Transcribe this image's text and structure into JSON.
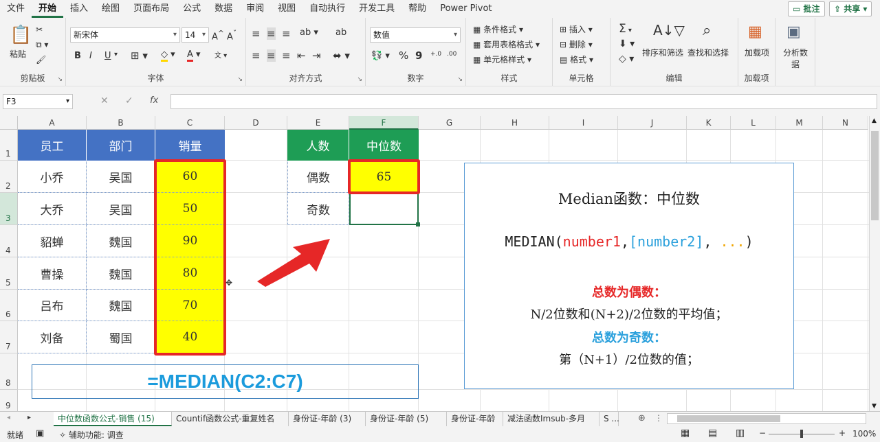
{
  "menu": [
    "文件",
    "开始",
    "插入",
    "绘图",
    "页面布局",
    "公式",
    "数据",
    "审阅",
    "视图",
    "自动执行",
    "开发工具",
    "帮助",
    "Power Pivot"
  ],
  "menu_active": "开始",
  "top_buttons": {
    "comment": "批注",
    "share": "共享"
  },
  "ribbon": {
    "clipboard": {
      "label": "剪贴板",
      "paste": "粘贴"
    },
    "font": {
      "label": "字体",
      "font_name": "新宋体",
      "font_size": "14",
      "bold": "B",
      "italic": "I",
      "underline": "U",
      "grow": "A^",
      "shrink": "Aˇ"
    },
    "align": {
      "label": "对齐方式"
    },
    "number": {
      "label": "数字",
      "format": "数值",
      "percent": "%",
      "comma": "9"
    },
    "styles": {
      "label": "样式",
      "cond": "条件格式",
      "table": "套用表格格式",
      "cell": "单元格样式"
    },
    "cells": {
      "label": "单元格",
      "insert": "插入",
      "delete": "删除",
      "format": "格式"
    },
    "edit": {
      "label": "编辑",
      "sort": "排序和筛选",
      "find": "查找和选择",
      "sum": "Σ"
    },
    "addins": {
      "label": "加载项",
      "addin": "加载项"
    },
    "analysis": {
      "label": "",
      "analyze": "分析数据"
    }
  },
  "formula_bar": {
    "name_box": "F3",
    "fx": "fx",
    "content": ""
  },
  "columns": [
    "A",
    "B",
    "C",
    "D",
    "E",
    "F",
    "G",
    "H",
    "I",
    "J",
    "K",
    "L",
    "M",
    "N"
  ],
  "rows": [
    "1",
    "2",
    "3",
    "4",
    "5",
    "6",
    "7",
    "8",
    "9"
  ],
  "table1": {
    "headers": [
      "员工",
      "部门",
      "销量"
    ],
    "rows": [
      [
        "小乔",
        "吴国",
        "60"
      ],
      [
        "大乔",
        "吴国",
        "50"
      ],
      [
        "貂蝉",
        "魏国",
        "90"
      ],
      [
        "曹操",
        "魏国",
        "80"
      ],
      [
        "吕布",
        "魏国",
        "70"
      ],
      [
        "刘备",
        "蜀国",
        "40"
      ]
    ]
  },
  "table2": {
    "headers": [
      "人数",
      "中位数"
    ],
    "rows": [
      [
        "偶数",
        "65"
      ],
      [
        "奇数",
        ""
      ]
    ]
  },
  "formula_display": "=MEDIAN(C2:C7)",
  "note": {
    "title": "Median函数：中位数",
    "syntax_fn": "MEDIAN(",
    "syntax_arg1": "number1",
    "syntax_sep1": ",",
    "syntax_arg2": "[number2]",
    "syntax_sep2": ", ",
    "syntax_arg3": "...",
    "syntax_close": ")",
    "even_title": "总数为偶数：",
    "even_desc": "N/2位数和(N+2)/2位数的平均值；",
    "odd_title": "总数为奇数：",
    "odd_desc": "第（N+1）/2位数的值；",
    "colors": {
      "red": "#e62727",
      "blue": "#2aa0dc",
      "orange": "#f0a500"
    }
  },
  "sheet_tabs": [
    "中位数函数公式-销售 (15)",
    "Countif函数公式-重复姓名",
    "身份证-年龄 (3)",
    "身份证-年龄 (5)",
    "身份证-年龄",
    "减法函数Imsub-多月",
    "S ..."
  ],
  "status": {
    "ready": "就绪",
    "accessibility": "辅助功能: 调查",
    "zoom": "100%"
  }
}
